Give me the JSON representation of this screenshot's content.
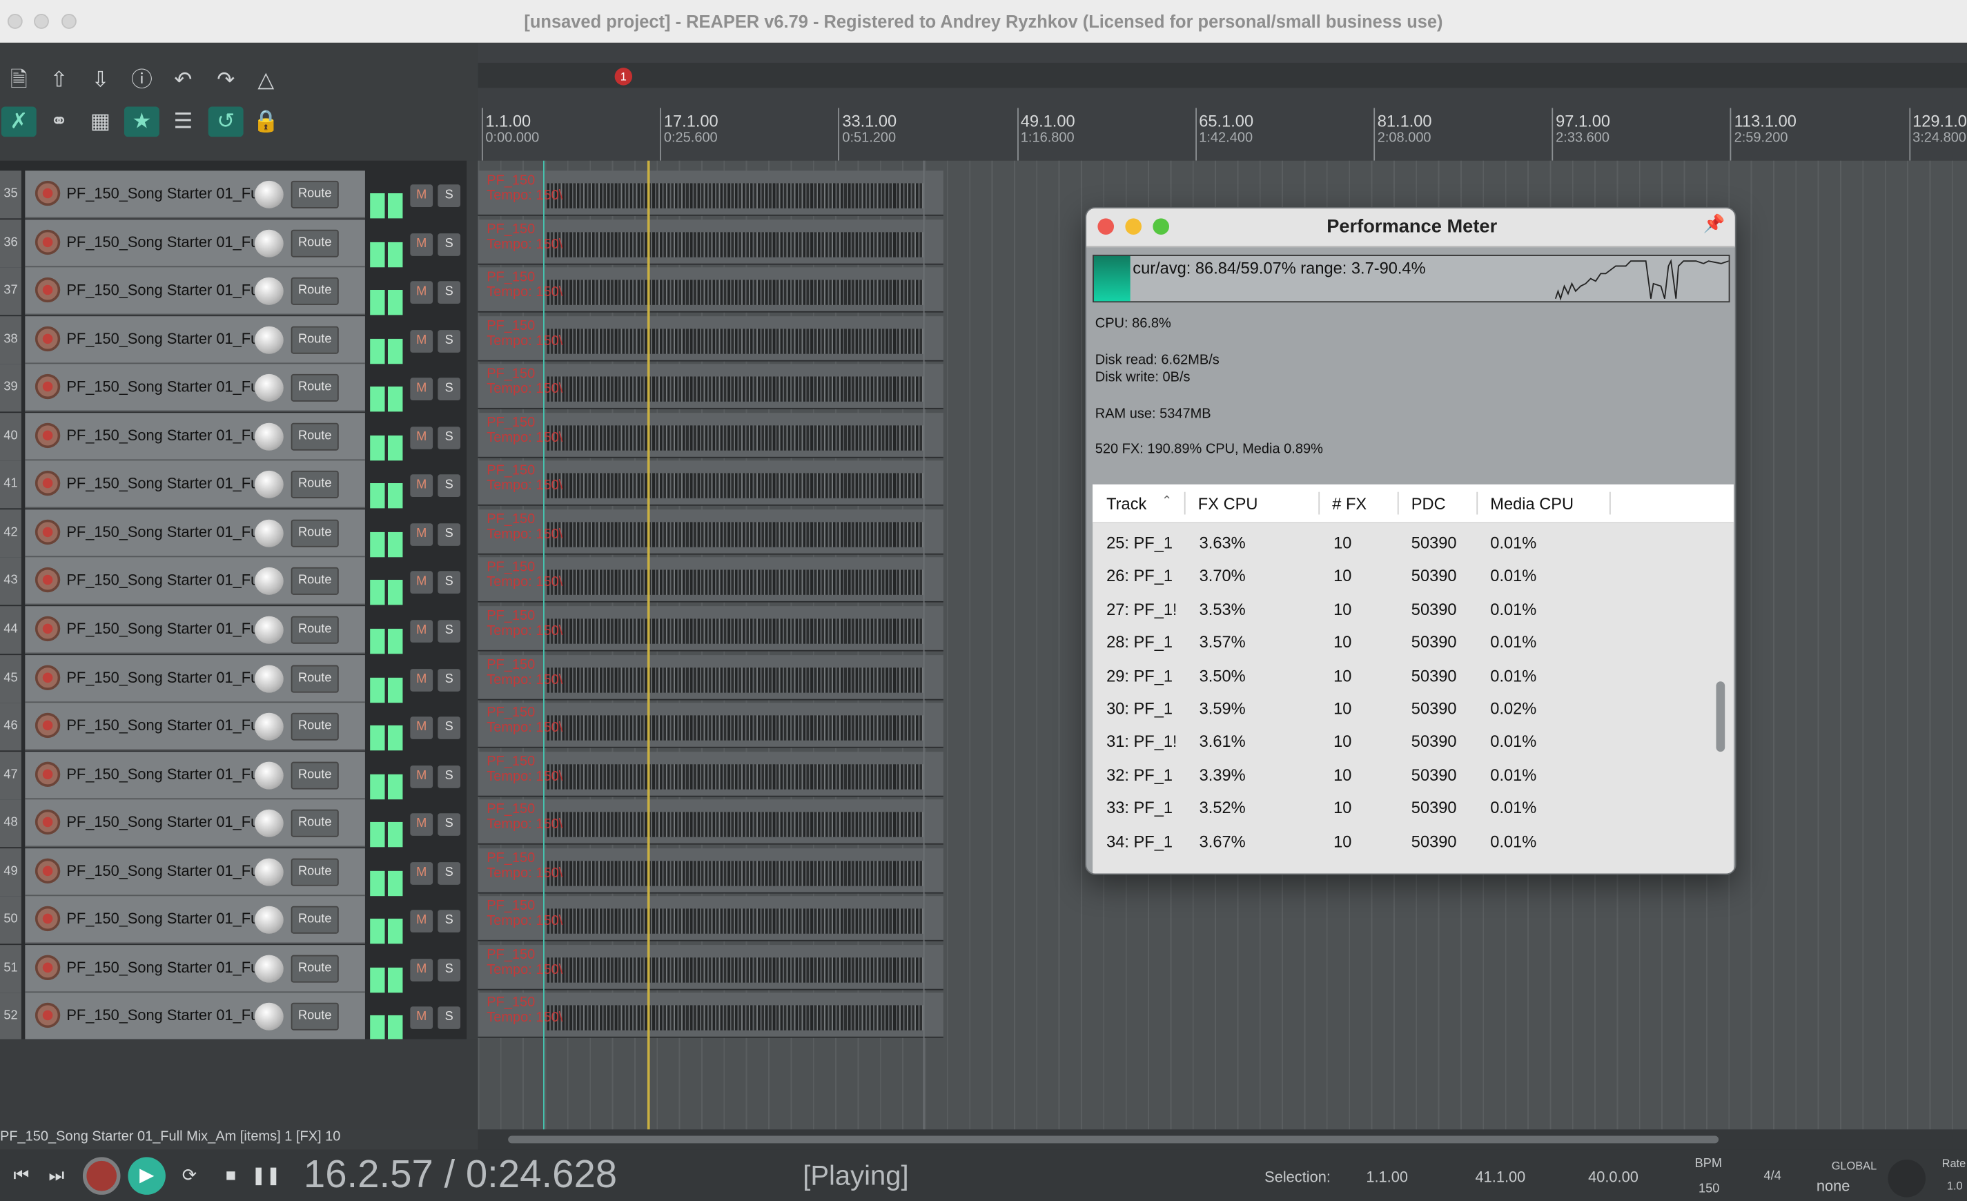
{
  "window": {
    "title": "[unsaved project] - REAPER v6.79 - Registered to Andrey Ryzhkov (Licensed for personal/small business use)"
  },
  "ruler": {
    "marker": "1",
    "ticks": [
      {
        "bar": "1.1.00",
        "time": "0:00.000"
      },
      {
        "bar": "17.1.00",
        "time": "0:25.600"
      },
      {
        "bar": "33.1.00",
        "time": "0:51.200"
      },
      {
        "bar": "49.1.00",
        "time": "1:16.800"
      },
      {
        "bar": "65.1.00",
        "time": "1:42.400"
      },
      {
        "bar": "81.1.00",
        "time": "2:08.000"
      },
      {
        "bar": "97.1.00",
        "time": "2:33.600"
      },
      {
        "bar": "113.1.00",
        "time": "2:59.200"
      },
      {
        "bar": "129.1.00",
        "time": "3:24.800"
      }
    ]
  },
  "track_common": {
    "name": "PF_150_Song Starter 01_Fu",
    "route": "Route",
    "mute": "M",
    "solo": "S",
    "item_label_1": "PF_150",
    "item_label_2": "Tempo: 150\\"
  },
  "tracks": [
    {
      "num": "35"
    },
    {
      "num": "36"
    },
    {
      "num": "37"
    },
    {
      "num": "38"
    },
    {
      "num": "39"
    },
    {
      "num": "40"
    },
    {
      "num": "41"
    },
    {
      "num": "42"
    },
    {
      "num": "43"
    },
    {
      "num": "44"
    },
    {
      "num": "45"
    },
    {
      "num": "46"
    },
    {
      "num": "47"
    },
    {
      "num": "48"
    },
    {
      "num": "49"
    },
    {
      "num": "50"
    },
    {
      "num": "51"
    },
    {
      "num": "52"
    }
  ],
  "status_line": "PF_150_Song Starter 01_Full Mix_Am [items] 1 [FX] 10",
  "transport": {
    "position": "16.2.57 / 0:24.628",
    "state": "[Playing]",
    "selection_label": "Selection:",
    "sel_start": "1.1.00",
    "sel_end": "41.1.00",
    "sel_length": "40.0.00",
    "bpm_label": "BPM",
    "bpm_value": "150",
    "time_sig": "4/4",
    "global_label": "GLOBAL",
    "global_value": "none",
    "rate_label": "Rate",
    "rate_value": "1.0"
  },
  "perf": {
    "title": "Performance Meter",
    "graph_text": "cur/avg: 86.84/59.07%  range: 3.7-90.4%",
    "cpu_percent": 86.8,
    "cpu": "CPU: 86.8%",
    "disk_read": "Disk read: 6.62MB/s",
    "disk_write": "Disk write: 0B/s",
    "ram": "RAM use: 5347MB",
    "fx": "520 FX: 190.89% CPU, Media 0.89%",
    "columns": [
      "Track",
      "FX CPU",
      "# FX",
      "PDC",
      "Media CPU"
    ],
    "rows": [
      {
        "track": "25: PF_1",
        "fxcpu": "3.63%",
        "nfx": "10",
        "pdc": "50390",
        "media": "0.01%"
      },
      {
        "track": "26: PF_1",
        "fxcpu": "3.70%",
        "nfx": "10",
        "pdc": "50390",
        "media": "0.01%"
      },
      {
        "track": "27: PF_1!",
        "fxcpu": "3.53%",
        "nfx": "10",
        "pdc": "50390",
        "media": "0.01%"
      },
      {
        "track": "28: PF_1",
        "fxcpu": "3.57%",
        "nfx": "10",
        "pdc": "50390",
        "media": "0.01%"
      },
      {
        "track": "29: PF_1",
        "fxcpu": "3.50%",
        "nfx": "10",
        "pdc": "50390",
        "media": "0.01%"
      },
      {
        "track": "30: PF_1",
        "fxcpu": "3.59%",
        "nfx": "10",
        "pdc": "50390",
        "media": "0.02%"
      },
      {
        "track": "31: PF_1!",
        "fxcpu": "3.61%",
        "nfx": "10",
        "pdc": "50390",
        "media": "0.01%"
      },
      {
        "track": "32: PF_1",
        "fxcpu": "3.39%",
        "nfx": "10",
        "pdc": "50390",
        "media": "0.01%"
      },
      {
        "track": "33: PF_1",
        "fxcpu": "3.52%",
        "nfx": "10",
        "pdc": "50390",
        "media": "0.01%"
      },
      {
        "track": "34: PF_1",
        "fxcpu": "3.67%",
        "nfx": "10",
        "pdc": "50390",
        "media": "0.01%"
      }
    ]
  },
  "icons": {
    "new": "file-icon",
    "save": "save-icon",
    "load": "open-icon",
    "info": "info-icon",
    "undo": "undo-icon",
    "redo": "redo-icon",
    "metronome": "metronome-icon",
    "ripple": "ripple-icon",
    "link": "link-icon",
    "grid": "grid-icon",
    "group": "group-icon",
    "snap": "snap-icon",
    "loop": "loop-icon",
    "lock": "lock-icon"
  },
  "colors": {
    "accent": "#2fb49a",
    "record": "#a13a34",
    "meter": "#6ef0a0",
    "item_label": "#c23a3a"
  }
}
